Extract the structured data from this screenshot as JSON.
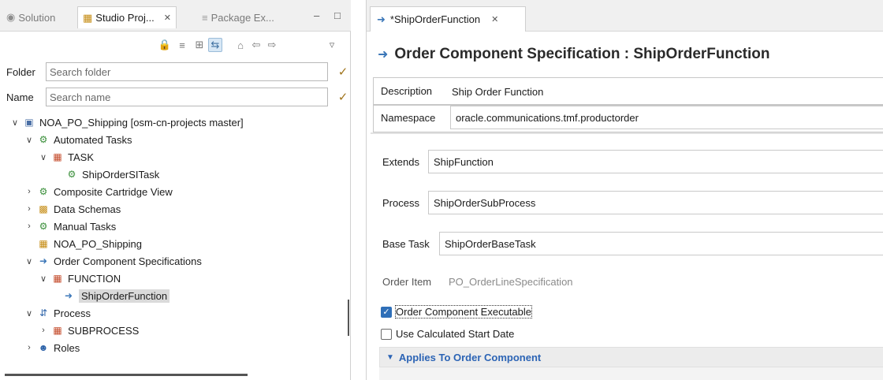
{
  "left_panel": {
    "tabs": [
      {
        "label": "Solution",
        "icon": "solution-icon"
      },
      {
        "label": "Studio Proj...",
        "icon": "studio-project-icon",
        "close": "✕"
      },
      {
        "label": "Package Ex...",
        "icon": "package-explorer-icon"
      }
    ],
    "window_buttons": {
      "minimize": "–",
      "maximize": "□"
    },
    "toolbar_icons": [
      "lock-icon",
      "collapse-all-icon",
      "filter-grid-icon",
      "link-with-editor-icon",
      "home-icon",
      "back-icon",
      "forward-icon",
      "view-menu-icon"
    ],
    "folder_filter": {
      "label": "Folder",
      "placeholder": "Search folder"
    },
    "name_filter": {
      "label": "Name",
      "placeholder": "Search name"
    },
    "tree": [
      {
        "label": "NOA_PO_Shipping [osm-cn-projects master]",
        "expanded": true
      },
      {
        "label": "Automated Tasks",
        "expanded": true
      },
      {
        "label": "TASK",
        "expanded": true
      },
      {
        "label": "ShipOrderSITask"
      },
      {
        "label": "Composite Cartridge View",
        "expanded": false
      },
      {
        "label": "Data Schemas",
        "expanded": false
      },
      {
        "label": "Manual Tasks",
        "expanded": false
      },
      {
        "label": "NOA_PO_Shipping"
      },
      {
        "label": "Order Component Specifications",
        "expanded": true
      },
      {
        "label": "FUNCTION",
        "expanded": true
      },
      {
        "label": "ShipOrderFunction",
        "selected": true
      },
      {
        "label": "Process",
        "expanded": true
      },
      {
        "label": "SUBPROCESS",
        "expanded": false
      },
      {
        "label": "Roles",
        "expanded": false
      }
    ]
  },
  "editor": {
    "tab_label": "*ShipOrderFunction",
    "tab_close": "✕",
    "title": "Order Component Specification : ShipOrderFunction",
    "description": {
      "label": "Description",
      "value": "Ship Order Function"
    },
    "namespace": {
      "label": "Namespace",
      "value": "oracle.communications.tmf.productorder"
    },
    "extends": {
      "label": "Extends",
      "value": "ShipFunction"
    },
    "process": {
      "label": "Process",
      "value": "ShipOrderSubProcess"
    },
    "base_task": {
      "label": "Base Task",
      "value": "ShipOrderBaseTask"
    },
    "order_item": {
      "label": "Order Item",
      "value": "PO_OrderLineSpecification"
    },
    "executable": {
      "label": "Order Component Executable",
      "checked": true
    },
    "use_calc_start": {
      "label": "Use Calculated Start Date",
      "checked": false
    },
    "section_title": "Applies To Order Component"
  },
  "colors": {
    "accent": "#2f6fb8",
    "section_text": "#2c64b5"
  }
}
